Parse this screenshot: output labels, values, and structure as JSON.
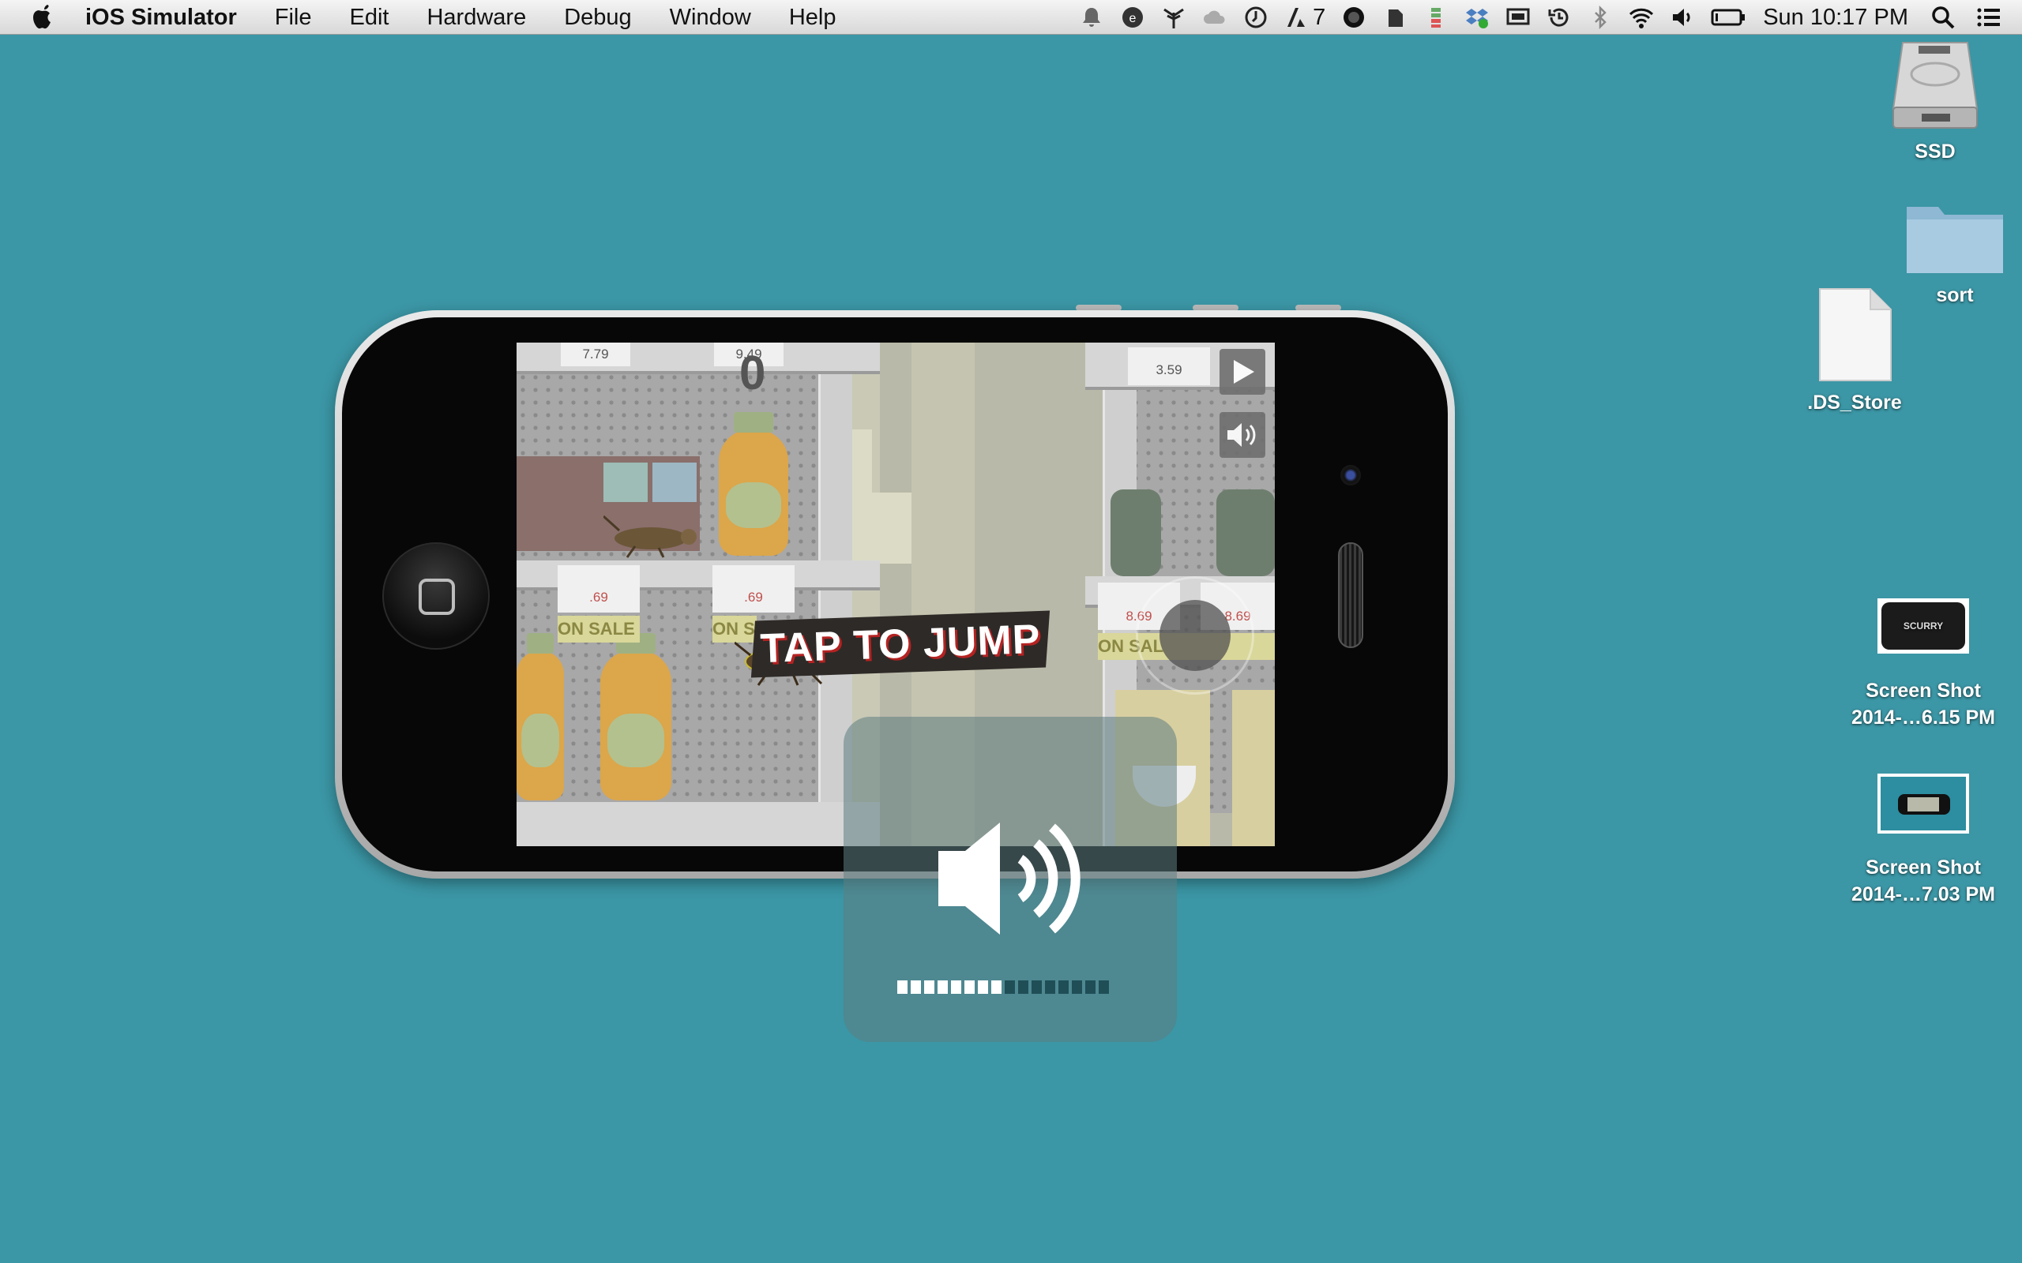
{
  "menubar": {
    "app_name": "iOS Simulator",
    "menus": [
      "File",
      "Edit",
      "Hardware",
      "Debug",
      "Window",
      "Help"
    ],
    "status_badge": "7",
    "clock": "Sun 10:17 PM",
    "status_icons": [
      "notification-icon",
      "app-icon",
      "antenna-icon",
      "cloud-icon",
      "timer-icon",
      "adobe-icon",
      "circle-icon",
      "evernote-icon",
      "battery-bars-icon",
      "dropbox-icon",
      "display-icon",
      "time-machine-icon",
      "bluetooth-icon",
      "wifi-icon",
      "volume-icon",
      "battery-icon",
      "spotlight-icon",
      "notification-center-icon"
    ]
  },
  "desktop": {
    "ssd_label": "SSD",
    "sort_label": "sort",
    "ds_store_label": ".DS_Store",
    "shot1_line1": "Screen Shot",
    "shot1_line2": "2014-…6.15 PM",
    "shot1_thumb_text": "SCURRY",
    "shot2_line1": "Screen Shot",
    "shot2_line2": "2014-…7.03 PM"
  },
  "game": {
    "score": "0",
    "tap_to_jump": "TAP TO JUMP",
    "price_tags": [
      "7.79",
      "9.49",
      "3.59",
      ".69",
      ".69",
      "8.69",
      "8.69"
    ],
    "sale_text": "ON SALE",
    "sale_text_partial": "ON S",
    "sale_text_partial2": "ON SAL"
  },
  "volume": {
    "level_fraction": 0.5,
    "segments": 16,
    "filled": 8
  },
  "colors": {
    "desktop": "#3b96a5",
    "hud": "#5f7d82"
  }
}
